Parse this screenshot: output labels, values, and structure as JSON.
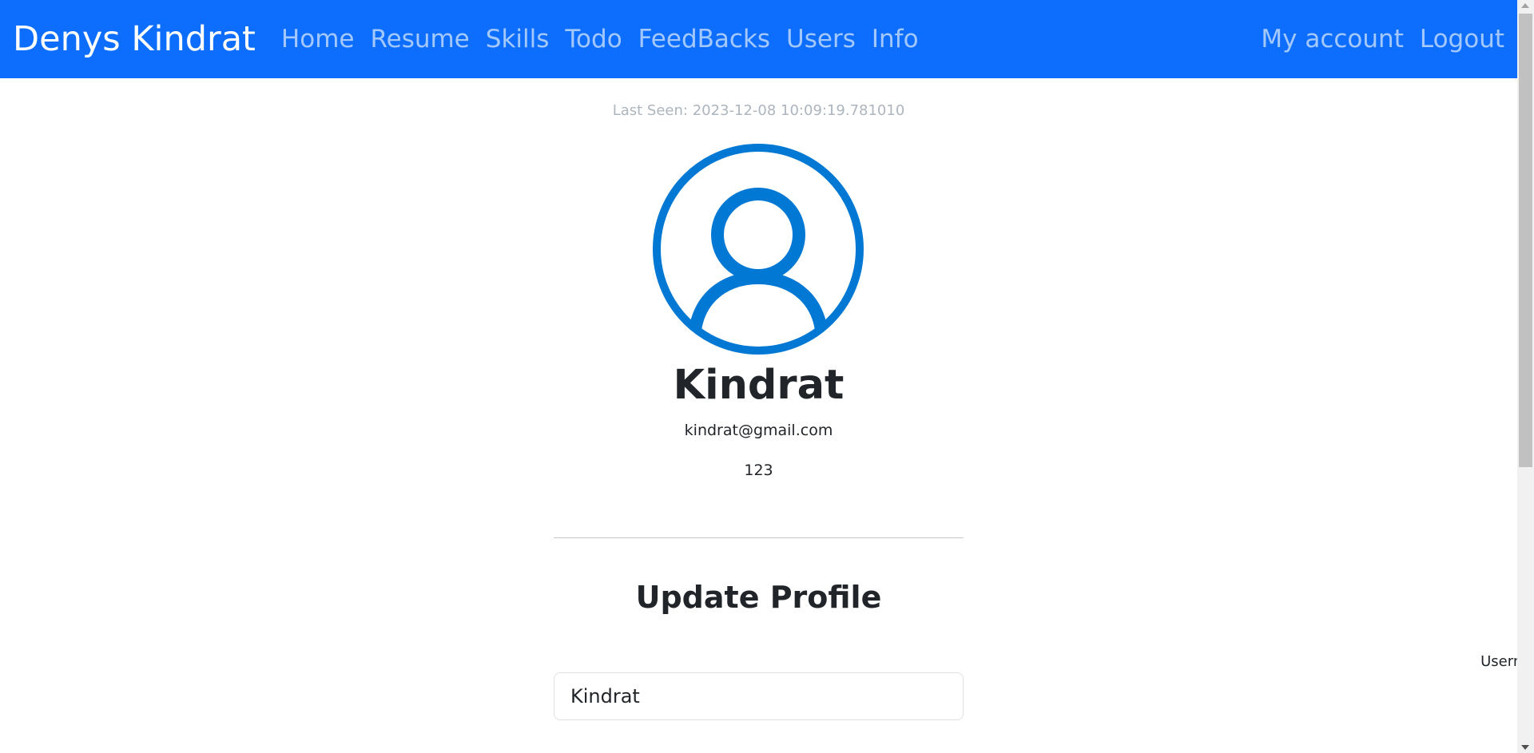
{
  "navbar": {
    "brand": "Denys Kindrat",
    "links": [
      {
        "label": "Home"
      },
      {
        "label": "Resume"
      },
      {
        "label": "Skills"
      },
      {
        "label": "Todo"
      },
      {
        "label": "FeedBacks"
      },
      {
        "label": "Users"
      },
      {
        "label": "Info"
      }
    ],
    "right_links": [
      {
        "label": "My account"
      },
      {
        "label": "Logout"
      }
    ],
    "background_color": "#0d6efd"
  },
  "profile": {
    "last_seen": "Last Seen: 2023-12-08 10:09:19.781010",
    "avatar_icon": "user-circle-icon",
    "avatar_color": "#0078d4",
    "name": "Kindrat",
    "email": "kindrat@gmail.com",
    "phone": "123"
  },
  "update_form": {
    "title": "Update Profile",
    "username_label": "Username",
    "username_value": "Kindrat"
  }
}
